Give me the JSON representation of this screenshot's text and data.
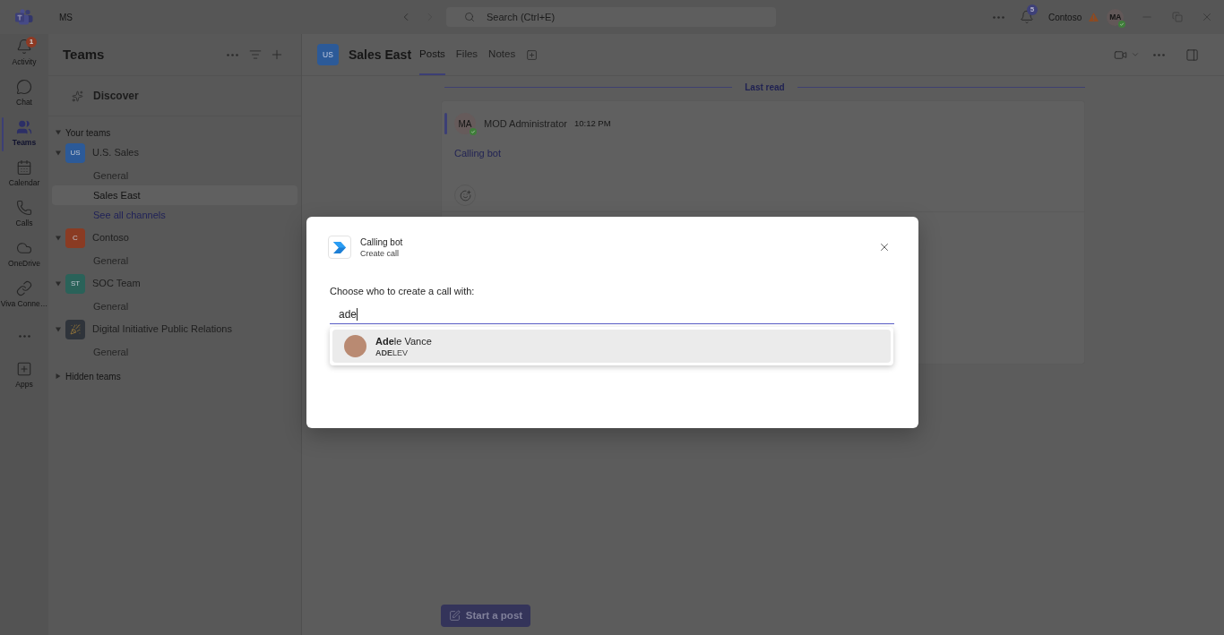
{
  "title_bar": {
    "org_label": "MS",
    "search": {
      "placeholder": "Search (Ctrl+E)"
    },
    "notification_count": "5",
    "tenant": "Contoso",
    "user_initials": "MA",
    "user_available": true
  },
  "app_bar": [
    {
      "kind": "activity",
      "label": "Activity",
      "badge": "1",
      "selected": false
    },
    {
      "kind": "chat",
      "label": "Chat",
      "selected": false
    },
    {
      "kind": "teams",
      "label": "Teams",
      "selected": true
    },
    {
      "kind": "calendar",
      "label": "Calendar",
      "selected": false
    },
    {
      "kind": "calls",
      "label": "Calls",
      "selected": false
    },
    {
      "kind": "onedrive",
      "label": "OneDrive",
      "selected": false
    },
    {
      "kind": "viva",
      "label": "Viva Conne…",
      "selected": false
    },
    {
      "kind": "more",
      "selected": false
    },
    {
      "kind": "apps",
      "label": "Apps",
      "selected": false
    }
  ],
  "teams_panel": {
    "title": "Teams",
    "discover": "Discover",
    "your_teams": {
      "label": "Your teams",
      "expanded": true
    },
    "teams": [
      {
        "name": "U.S. Sales",
        "kind": "initials",
        "initials": "US",
        "color": "#2c5a98",
        "expanded": true,
        "channels": [
          {
            "name": "General",
            "selected": false
          },
          {
            "name": "Sales East",
            "selected": true
          }
        ],
        "see_all": "See all channels"
      },
      {
        "name": "Contoso",
        "kind": "initials",
        "initials": "C",
        "color": "#8a3b23",
        "expanded": true,
        "channels": [
          {
            "name": "General",
            "selected": false
          }
        ]
      },
      {
        "name": "SOC Team",
        "kind": "initials",
        "initials": "ST",
        "color": "#2a6259",
        "expanded": true,
        "channels": [
          {
            "name": "General",
            "selected": false
          }
        ]
      },
      {
        "name": "Digital Initiative Public Relations",
        "kind": "image",
        "color": "#2f343b",
        "expanded": true,
        "channels": [
          {
            "name": "General",
            "selected": false
          }
        ]
      }
    ],
    "hidden_teams": {
      "label": "Hidden teams",
      "expanded": false
    }
  },
  "channel": {
    "initials": "US",
    "color": "#2c5a98",
    "name": "Sales East",
    "tabs": [
      {
        "label": "Posts",
        "selected": true
      },
      {
        "label": "Files",
        "selected": false
      },
      {
        "label": "Notes",
        "selected": false
      }
    ]
  },
  "feed": {
    "divider_label": "Last read",
    "messages": [
      {
        "author": "MOD Administrator",
        "initials": "MA",
        "available": true,
        "time": "10:12 PM",
        "text": "Calling bot"
      }
    ],
    "compose_button": "Start a post"
  },
  "dialog": {
    "app_name": "Calling bot",
    "subtitle": "Create call",
    "prompt": "Choose who to create a call with:",
    "input": {
      "value": "ade"
    },
    "suggestions": [
      {
        "name": "**Ade**le Vance",
        "username": "**ADE**LEV",
        "selected": true
      }
    ]
  }
}
